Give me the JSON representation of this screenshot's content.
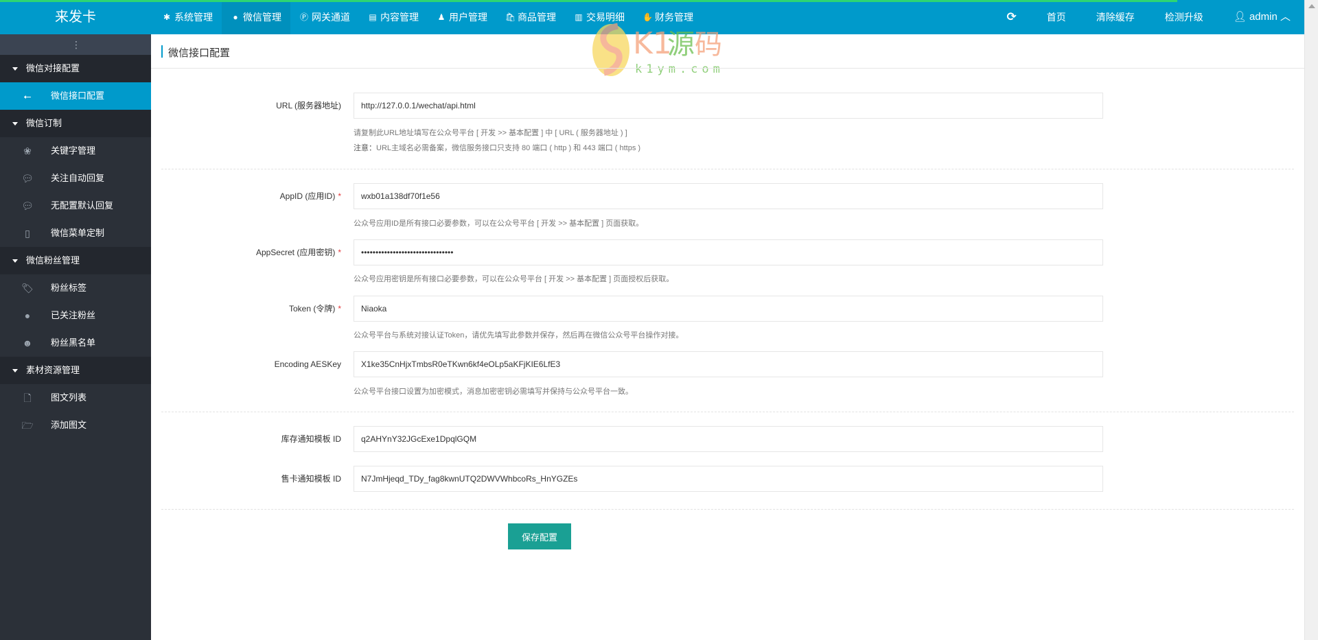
{
  "header": {
    "logo": "来发卡",
    "nav": [
      {
        "label": "系统管理",
        "icon": "gear-icon"
      },
      {
        "label": "微信管理",
        "icon": "wechat-icon",
        "active": true
      },
      {
        "label": "网关通道",
        "icon": "paypal-icon"
      },
      {
        "label": "内容管理",
        "icon": "file-icon"
      },
      {
        "label": "用户管理",
        "icon": "users-icon"
      },
      {
        "label": "商品管理",
        "icon": "shopping-bag-icon"
      },
      {
        "label": "交易明细",
        "icon": "bar-chart-icon"
      },
      {
        "label": "财务管理",
        "icon": "money-icon"
      }
    ],
    "right": {
      "home": "首页",
      "clear_cache": "清除缓存",
      "upgrade": "检测升级",
      "user": "admin"
    }
  },
  "watermark": {
    "brand": "K1源码",
    "domain": "k1ym.com"
  },
  "sidebar": {
    "groups": [
      {
        "label": "微信对接配置",
        "items": [
          {
            "label": "微信接口配置",
            "icon": "usb-icon",
            "active": true
          }
        ]
      },
      {
        "label": "微信订制",
        "items": [
          {
            "label": "关键字管理",
            "icon": "paw-icon"
          },
          {
            "label": "关注自动回复",
            "icon": "comment-icon"
          },
          {
            "label": "无配置默认回复",
            "icon": "comment-icon"
          },
          {
            "label": "微信菜单定制",
            "icon": "mobile-icon"
          }
        ]
      },
      {
        "label": "微信粉丝管理",
        "items": [
          {
            "label": "粉丝标签",
            "icon": "tag-icon"
          },
          {
            "label": "已关注粉丝",
            "icon": "wechat-icon"
          },
          {
            "label": "粉丝黑名单",
            "icon": "reddit-icon"
          }
        ]
      },
      {
        "label": "素材资源管理",
        "items": [
          {
            "label": "图文列表",
            "icon": "file-pdf-icon"
          },
          {
            "label": "添加图文",
            "icon": "folder-open-icon"
          }
        ]
      }
    ]
  },
  "page": {
    "title": "微信接口配置",
    "url": {
      "label": "URL (服务器地址)",
      "value": "http://127.0.0.1/wechat/api.html",
      "help1": "请复制此URL地址填写在公众号平台 [ 开发 >> 基本配置 ] 中 [ URL ( 服务器地址 ) ]",
      "note_label": "注意：",
      "help2": "URL主域名必需备案，微信服务接口只支持 80 端口 ( http ) 和 443 端口 ( https )"
    },
    "appid": {
      "label": "AppID (应用ID)",
      "value": "wxb01a138df70f1e56",
      "help": "公众号应用ID是所有接口必要参数，可以在公众号平台 [ 开发 >> 基本配置 ] 页面获取。"
    },
    "appsecret": {
      "label": "AppSecret (应用密钥)",
      "value": "********************************",
      "help": "公众号应用密钥是所有接口必要参数，可以在公众号平台 [ 开发 >> 基本配置 ] 页面授权后获取。"
    },
    "token": {
      "label": "Token (令牌)",
      "value": "Niaoka",
      "help": "公众号平台与系统对接认证Token，请优先填写此参数并保存，然后再在微信公众号平台操作对接。"
    },
    "aeskey": {
      "label": "Encoding AESKey",
      "value": "X1ke35CnHjxTmbsR0eTKwn6kf4eOLp5aKFjKIE6LfE3",
      "help": "公众号平台接口设置为加密模式，消息加密密钥必需填写并保持与公众号平台一致。"
    },
    "stock_tpl": {
      "label": "库存通知模板 ID",
      "value": "q2AHYnY32JGcExe1DpqlGQM"
    },
    "sale_tpl": {
      "label": "售卡通知模板 ID",
      "value": "N7JmHjeqd_TDy_fag8kwnUTQ2DWVWhbcoRs_HnYGZEs"
    },
    "save": "保存配置"
  }
}
